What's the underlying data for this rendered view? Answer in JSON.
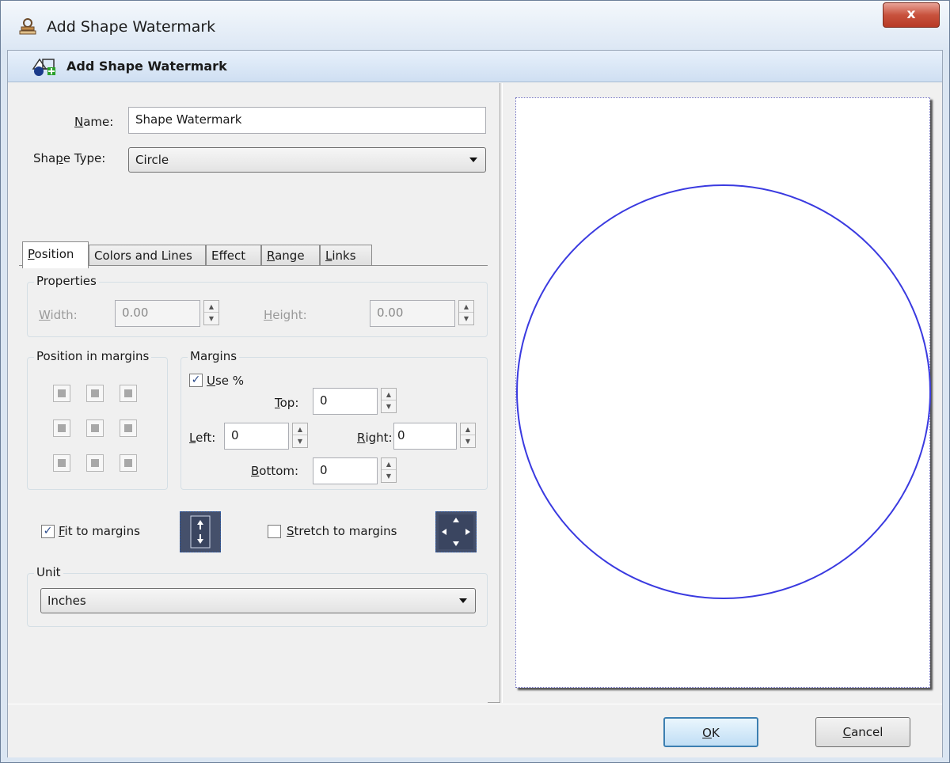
{
  "window": {
    "title": "Add Shape Watermark",
    "close_label": "x",
    "header": "Add Shape Watermark"
  },
  "form": {
    "name_label": "Name:",
    "name_value": "Shape Watermark",
    "shape_type_label": "Shape Type:",
    "shape_type_value": "Circle"
  },
  "tabs": [
    {
      "label": "Position",
      "active": true
    },
    {
      "label": "Colors and Lines",
      "active": false
    },
    {
      "label": "Effect",
      "active": false
    },
    {
      "label": "Range",
      "active": false
    },
    {
      "label": "Links",
      "active": false
    }
  ],
  "position_tab": {
    "properties": {
      "title": "Properties",
      "width_label": "Width:",
      "width_value": "0.00",
      "height_label": "Height:",
      "height_value": "0.00"
    },
    "position_in_margins_title": "Position in margins",
    "margins": {
      "title": "Margins",
      "use_percent_label": "Use %",
      "use_percent_checked": true,
      "top_label": "Top:",
      "top_value": "0",
      "left_label": "Left:",
      "left_value": "0",
      "right_label": "Right:",
      "right_value": "0",
      "bottom_label": "Bottom:",
      "bottom_value": "0"
    },
    "fit_to_margins_label": "Fit to margins",
    "fit_to_margins_checked": true,
    "stretch_to_margins_label": "Stretch to margins",
    "stretch_to_margins_checked": false,
    "unit": {
      "title": "Unit",
      "value": "Inches"
    }
  },
  "preview": {
    "shape": "circle",
    "stroke_color": "#3a3ae0"
  },
  "buttons": {
    "ok_label": "OK",
    "cancel_label": "Cancel"
  }
}
